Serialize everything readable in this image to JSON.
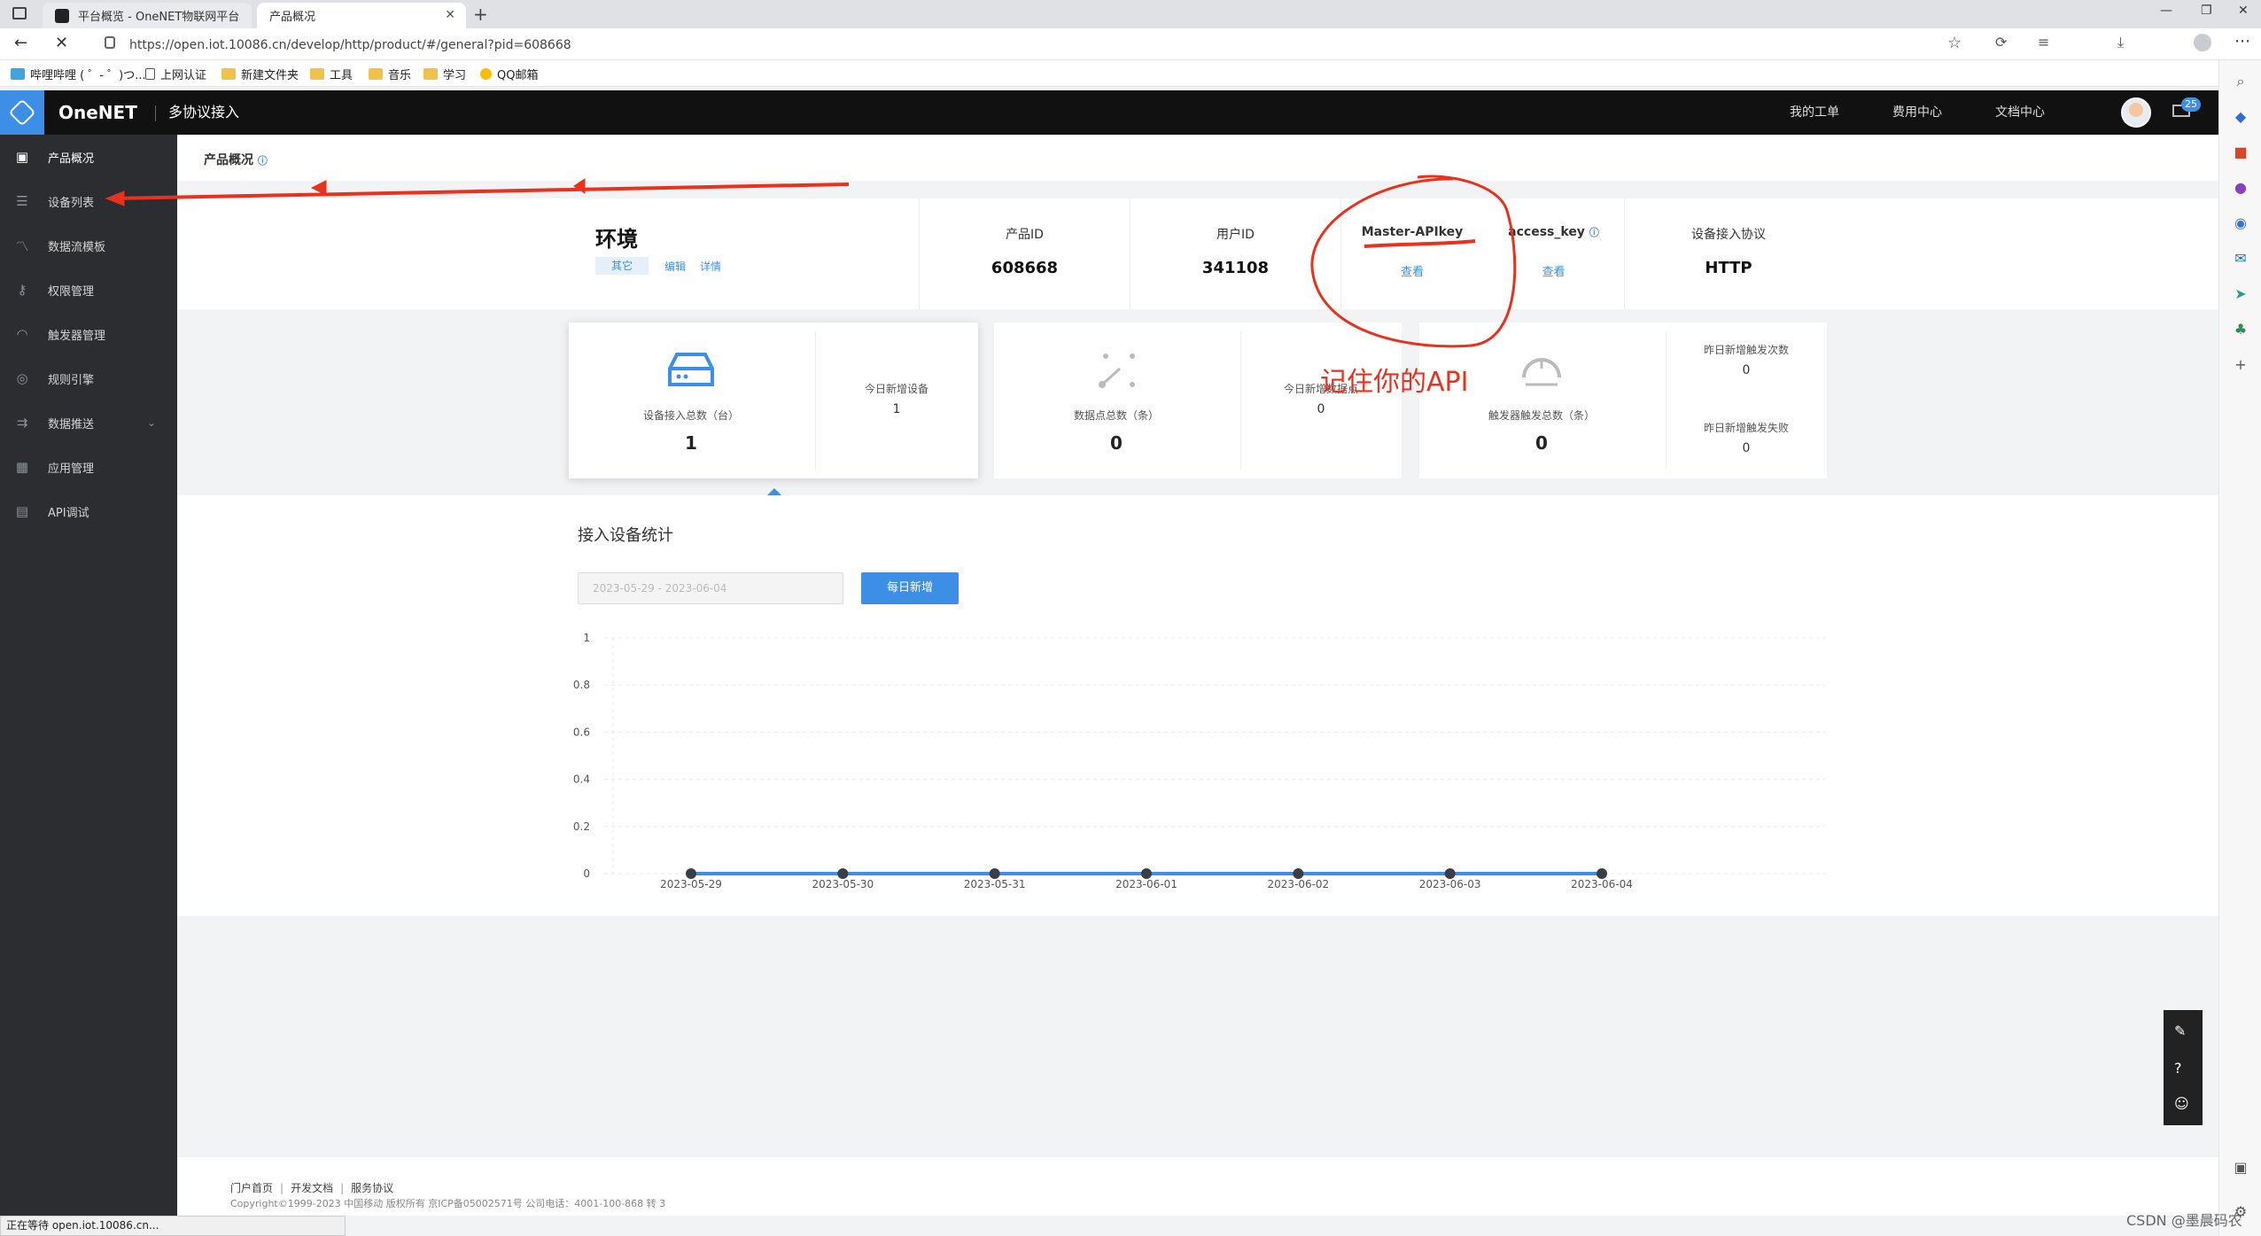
{
  "browser": {
    "tabs": [
      {
        "label": "平台概览 - OneNET物联网平台"
      },
      {
        "label": "产品概况"
      }
    ],
    "url": "https://open.iot.10086.cn/develop/http/product/#/general?pid=608668",
    "favorites": [
      "哔哩哔哩 ( ゜- ゜)つ...",
      "上网认证",
      "新建文件夹",
      "工具",
      "音乐",
      "学习",
      "QQ邮箱"
    ]
  },
  "header": {
    "brand": "OneNET",
    "section": "多协议接入",
    "links": [
      "我的工单",
      "费用中心",
      "文档中心"
    ],
    "mail_count": "25"
  },
  "sidebar": {
    "items": [
      {
        "label": "产品概况",
        "icon": "cube-icon"
      },
      {
        "label": "设备列表",
        "icon": "list-icon"
      },
      {
        "label": "数据流模板",
        "icon": "dataflow-icon"
      },
      {
        "label": "权限管理",
        "icon": "key-icon"
      },
      {
        "label": "触发器管理",
        "icon": "trigger-icon"
      },
      {
        "label": "规则引擎",
        "icon": "rule-icon"
      },
      {
        "label": "数据推送",
        "icon": "push-icon"
      },
      {
        "label": "应用管理",
        "icon": "grid-icon"
      },
      {
        "label": "API调试",
        "icon": "api-icon"
      }
    ]
  },
  "breadcrumb": "产品概况",
  "product": {
    "name": "环境",
    "tag": "其它",
    "edit": "编辑",
    "detail": "详情",
    "product_id_label": "产品ID",
    "product_id": "608668",
    "user_id_label": "用户ID",
    "user_id": "341108",
    "master_key_label": "Master-APIkey",
    "master_key_link": "查看",
    "access_key_label": "access_key",
    "access_key_link": "查看",
    "protocol_label": "设备接入协议",
    "protocol": "HTTP"
  },
  "stats": {
    "device_total_label": "设备接入总数（台）",
    "device_total": "1",
    "today_new_devices_label": "今日新增设备",
    "today_new_devices": "1",
    "datapoint_total_label": "数据点总数（条）",
    "datapoint_total": "0",
    "today_new_datapoints_label": "今日新增数据点",
    "today_new_datapoints": "0",
    "trigger_total_label": "触发器触发总数（条）",
    "trigger_total": "0",
    "yesterday_triggers_label": "昨日新增触发次数",
    "yesterday_triggers": "0",
    "yesterday_failures_label": "昨日新增触发失败",
    "yesterday_failures": "0"
  },
  "device_stats": {
    "title": "接入设备统计",
    "date_range_placeholder": "2023-05-29 - 2023-06-04",
    "daily_button": "每日新增"
  },
  "annotation": {
    "text": "记住你的API",
    "color": "#e8321e"
  },
  "footer": {
    "links": [
      "门户首页",
      "开发文档",
      "服务协议"
    ],
    "copyright": "Copyright©1999-2023 中国移动 版权所有 京ICP备05002571号 公司电话：4001-100-868 转 3"
  },
  "statusbar": "正在等待 open.iot.10086.cn...",
  "watermark": "CSDN @墨晨码农",
  "colors": {
    "accent": "#3d8ee5",
    "sidebar": "#2b2d30",
    "topbar": "#111111"
  },
  "chart_data": {
    "type": "line",
    "x": [
      "2023-05-29",
      "2023-05-30",
      "2023-05-31",
      "2023-06-01",
      "2023-06-02",
      "2023-06-03",
      "2023-06-04"
    ],
    "series": [
      {
        "values": [
          0,
          0,
          0,
          0,
          0,
          0,
          0
        ]
      }
    ],
    "yticks": [
      "0",
      "0.2",
      "0.4",
      "0.6",
      "0.8",
      "1"
    ],
    "ylim": [
      0,
      1
    ],
    "grid": true
  }
}
